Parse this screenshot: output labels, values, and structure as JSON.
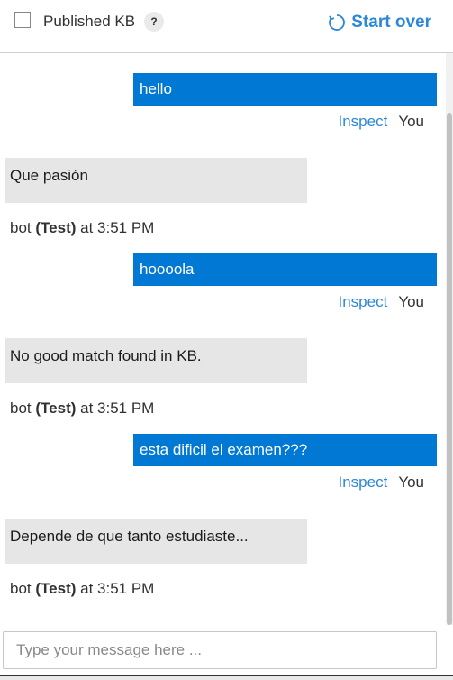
{
  "header": {
    "checkbox_label": "Published KB",
    "help": "?",
    "start_over": "Start over"
  },
  "messages": [
    {
      "from": "user",
      "text": "hello",
      "inspect": "Inspect",
      "who": "You"
    },
    {
      "from": "bot",
      "text": "Que pasión",
      "bot": "bot",
      "name": "(Test)",
      "at": "at 3:51 PM"
    },
    {
      "from": "user",
      "text": "hoooola",
      "inspect": "Inspect",
      "who": "You"
    },
    {
      "from": "bot",
      "text": "No good match found in KB.",
      "bot": "bot",
      "name": "(Test)",
      "at": "at 3:51 PM"
    },
    {
      "from": "user",
      "text": "esta dificil el examen???",
      "inspect": "Inspect",
      "who": "You"
    },
    {
      "from": "bot",
      "text": "Depende de que tanto estudiaste...",
      "bot": "bot",
      "name": "(Test)",
      "at": "at 3:51 PM"
    }
  ],
  "composer": {
    "placeholder": "Type your message here ..."
  },
  "colors": {
    "accent": "#0078d4",
    "bot_bubble": "#e6e6e6"
  }
}
